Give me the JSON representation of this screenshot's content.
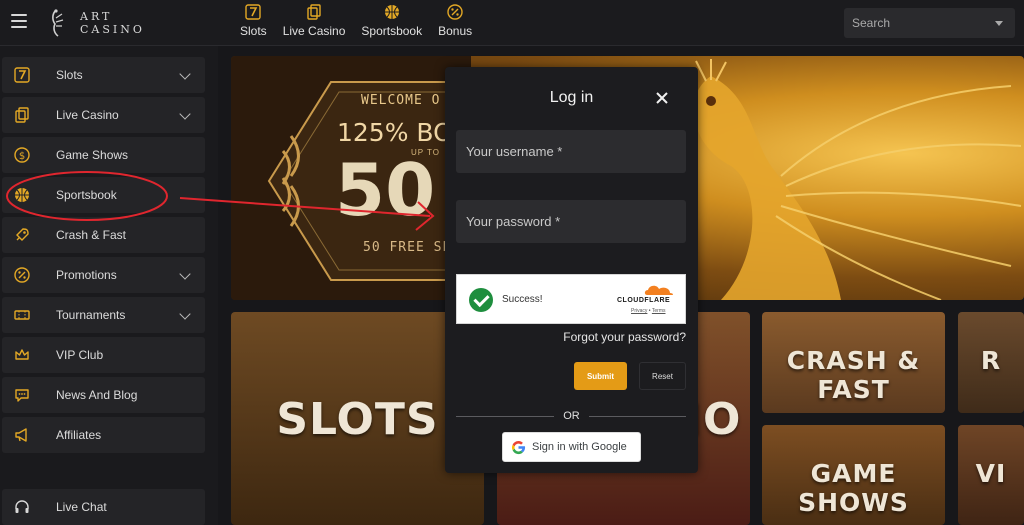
{
  "brand": {
    "name_line1": "ART",
    "name_line2": "CASINO"
  },
  "topnav": [
    {
      "label": "Slots",
      "icon": "seven-icon"
    },
    {
      "label": "Live Casino",
      "icon": "cards-icon"
    },
    {
      "label": "Sportsbook",
      "icon": "basketball-icon"
    },
    {
      "label": "Bonus",
      "icon": "percent-icon"
    }
  ],
  "search": {
    "placeholder": "Search"
  },
  "sidebar": {
    "items": [
      {
        "label": "Slots",
        "icon": "seven-icon",
        "expandable": true
      },
      {
        "label": "Live Casino",
        "icon": "cards-icon",
        "expandable": true
      },
      {
        "label": "Game Shows",
        "icon": "coin-icon",
        "expandable": false
      },
      {
        "label": "Sportsbook",
        "icon": "basketball-icon",
        "expandable": false
      },
      {
        "label": "Crash & Fast",
        "icon": "rocket-icon",
        "expandable": false
      },
      {
        "label": "Promotions",
        "icon": "percent-icon",
        "expandable": true
      },
      {
        "label": "Tournaments",
        "icon": "ticket-icon",
        "expandable": true
      },
      {
        "label": "VIP Club",
        "icon": "crown-icon",
        "expandable": false
      },
      {
        "label": "News And Blog",
        "icon": "chat-icon",
        "expandable": false
      },
      {
        "label": "Affiliates",
        "icon": "megaphone-icon",
        "expandable": false
      }
    ],
    "live_chat": {
      "label": "Live Chat",
      "icon": "headset-icon"
    }
  },
  "banner": {
    "welcome": "WELCOME O",
    "bonus": "125% BO",
    "upto": "UP TO",
    "amount": "50",
    "spins": "50 FREE SP"
  },
  "tiles": {
    "slots": "SLOTS",
    "live": "IO",
    "crash": "CRASH & FAST",
    "game_shows": "GAME SHOWS",
    "right_top": "R",
    "right_bottom": "VI"
  },
  "login_modal": {
    "title": "Log in",
    "username_placeholder": "Your username *",
    "password_placeholder": "Your password *",
    "captcha_status": "Success!",
    "captcha_brand": "CLOUDFLARE",
    "captcha_privacy": "Privacy",
    "captcha_sep": "•",
    "captcha_terms": "Terms",
    "forgot": "Forgot your password?",
    "submit": "Submit",
    "reset": "Reset",
    "or": "OR",
    "google": "Sign in with Google"
  },
  "colors": {
    "accent": "#e49b16",
    "annotation": "#e0262e",
    "captcha_ok": "#1e8e3e"
  }
}
